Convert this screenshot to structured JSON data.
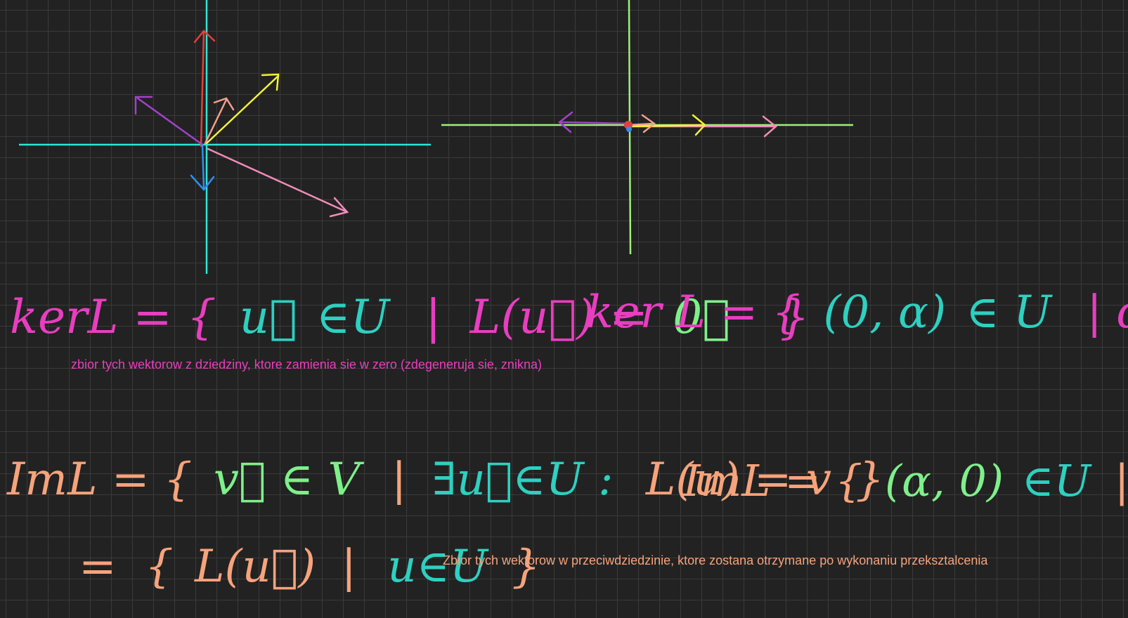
{
  "colors": {
    "cyan": "#2ee6d6",
    "green_axis": "#9ef07a",
    "red": "#e0413c",
    "yellow": "#f4f03a",
    "purple": "#a043c8",
    "pink": "#f08cb8",
    "salmon": "#f2a08c",
    "blue": "#2f8ff0",
    "magenta": "#e83ec0",
    "mint": "#7ef08a",
    "teal": "#2ed0c0",
    "orange": "#f6a37c"
  },
  "formulas": {
    "ker_def": {
      "head": "kerL = {",
      "vec": "u⃗",
      "in": "∈U",
      "bar": "|",
      "map": "L(u⃗) =",
      "zero": "0⃗",
      "close": "}"
    },
    "ker_example": {
      "head": "ker L = {",
      "pair": "(0, α)",
      "in": "∈ U",
      "cond": "| α∈R }"
    },
    "im_def": {
      "head": "ImL = {",
      "vec": "v⃗ ∈ V",
      "bar": "|",
      "exists": "∃u⃗∈U :",
      "map": "L(u) = v",
      "close": "}"
    },
    "im_def2": {
      "eq": "=",
      "open": "{",
      "map": "L(u⃗)",
      "bar": "|",
      "dom": "u∈U",
      "close": "}"
    },
    "im_example": {
      "head": "ImL = {",
      "pair": "(α, 0)",
      "in": "∈U",
      "cond": "| α∈R }"
    }
  },
  "notes": {
    "ker": "zbior tych wektorow z dziedziny, ktore zamienia sie w zero (zdegeneruja sie, znikna)",
    "im": "Zbior tych wektorow w przeciwdziedzinie, ktore zostana otrzymane po wykonaniu przeksztalcenia"
  }
}
